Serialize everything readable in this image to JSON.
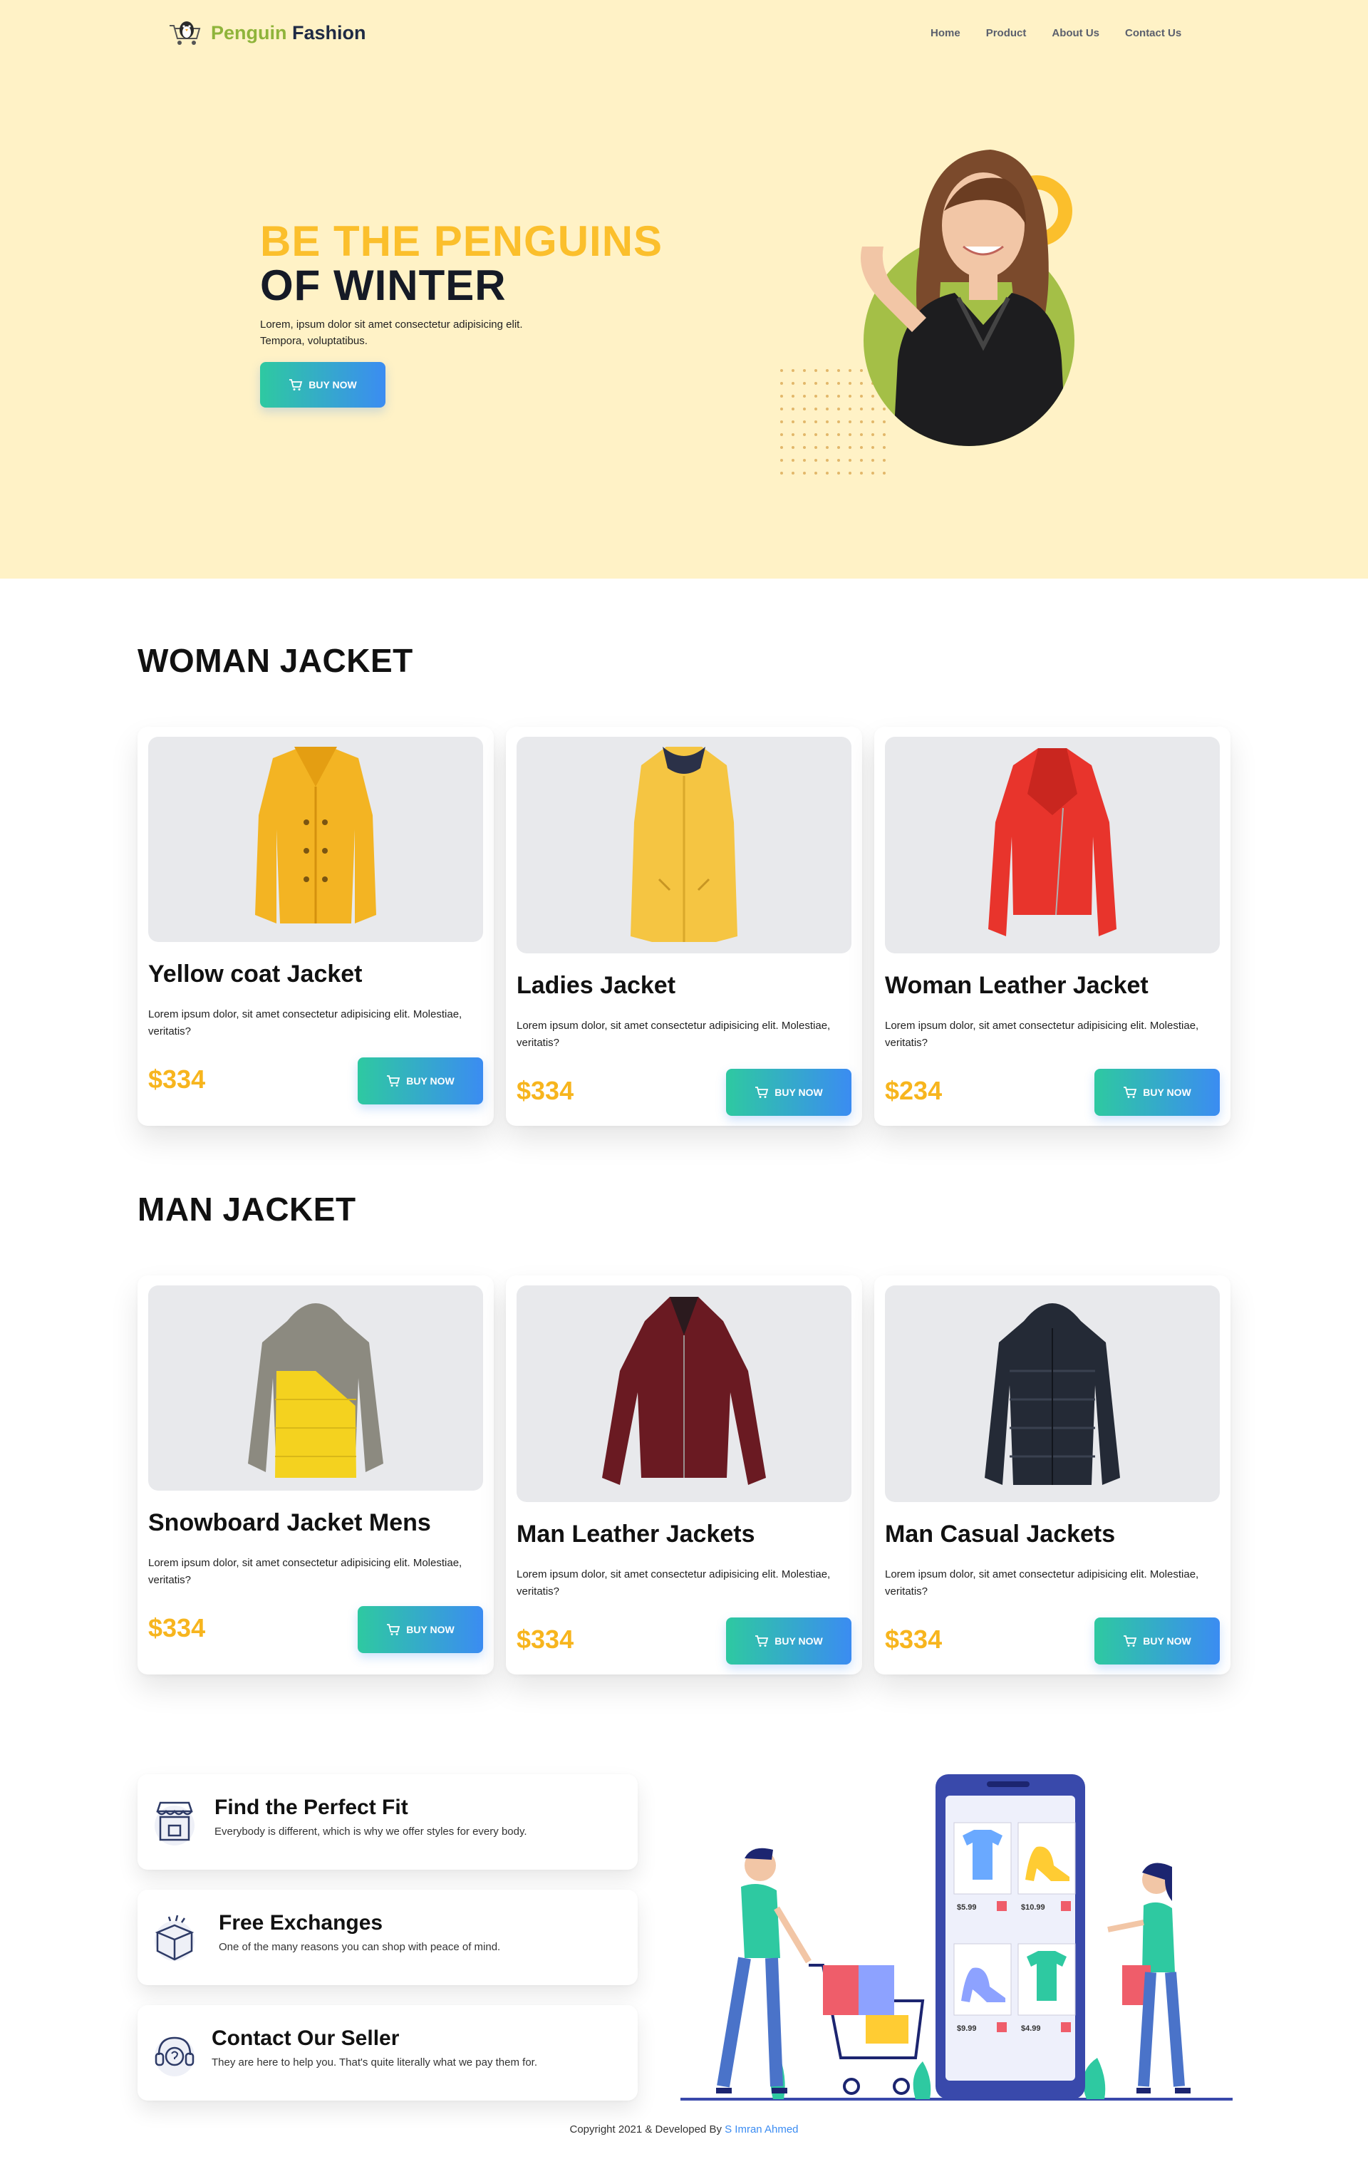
{
  "header": {
    "brand_first": "Penguin",
    "brand_second": "Fashion",
    "nav": [
      "Home",
      "Product",
      "About Us",
      "Contact Us"
    ]
  },
  "hero": {
    "title_line1": "BE THE PENGUINS",
    "title_line2": "OF WINTER",
    "text": "Lorem, ipsum dolor sit amet consectetur adipisicing elit. Tempora, voluptatibus.",
    "button": "BUY NOW"
  },
  "woman": {
    "title": "WOMAN JACKET",
    "products": [
      {
        "name": "Yellow coat Jacket",
        "desc": "Lorem ipsum dolor, sit amet consectetur adipisicing elit. Molestiae, veritatis?",
        "price": "$334",
        "button": "BUY NOW"
      },
      {
        "name": "Ladies Jacket",
        "desc": "Lorem ipsum dolor, sit amet consectetur adipisicing elit. Molestiae, veritatis?",
        "price": "$334",
        "button": "BUY NOW"
      },
      {
        "name": "Woman Leather Jacket",
        "desc": "Lorem ipsum dolor, sit amet consectetur adipisicing elit. Molestiae, veritatis?",
        "price": "$234",
        "button": "BUY NOW"
      }
    ]
  },
  "man": {
    "title": "MAN JACKET",
    "products": [
      {
        "name": "Snowboard Jacket Mens",
        "desc": "Lorem ipsum dolor, sit amet consectetur adipisicing elit. Molestiae, veritatis?",
        "price": "$334",
        "button": "BUY NOW"
      },
      {
        "name": "Man Leather Jackets",
        "desc": "Lorem ipsum dolor, sit amet consectetur adipisicing elit. Molestiae, veritatis?",
        "price": "$334",
        "button": "BUY NOW"
      },
      {
        "name": "Man Casual Jackets",
        "desc": "Lorem ipsum dolor, sit amet consectetur adipisicing elit. Molestiae, veritatis?",
        "price": "$334",
        "button": "BUY NOW"
      }
    ]
  },
  "features": [
    {
      "title": "Find the Perfect Fit",
      "text": "Everybody is different, which is why we offer styles for every body.",
      "icon": "store-icon"
    },
    {
      "title": "Free Exchanges",
      "text": "One of the many reasons you can shop with peace of mind.",
      "icon": "box-icon"
    },
    {
      "title": "Contact Our Seller",
      "text": "They are here to help you. That's quite literally what we pay them for.",
      "icon": "support-icon"
    }
  ],
  "shop_illustration": {
    "prices": [
      "$5.99",
      "$10.99",
      "$9.99",
      "$4.99"
    ]
  },
  "footer": {
    "text": "Copyright 2021 & Developed By",
    "author": "S Imran Ahmed"
  },
  "colors": {
    "hero_bg": "#fff2c6",
    "accent_yellow": "#fbbf2c",
    "price": "#f7b51e",
    "button_start": "#2ec9a1",
    "button_end": "#3b8cf2",
    "brand_green": "#8fb43a"
  }
}
